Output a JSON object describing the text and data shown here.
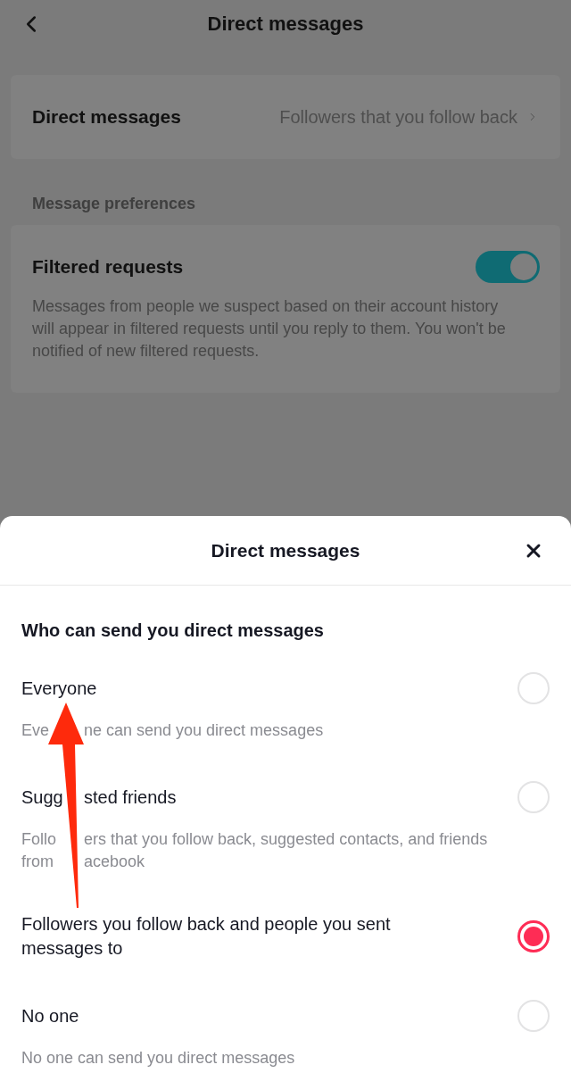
{
  "header": {
    "title": "Direct messages"
  },
  "direct_messages": {
    "label": "Direct messages",
    "value": "Followers that you follow back"
  },
  "message_preferences": {
    "title": "Message preferences",
    "filtered_requests": {
      "label": "Filtered requests",
      "on": true,
      "description": "Messages from people we suspect based on their account history will appear in filtered requests until you reply to them. You won't be notified of new filtered requests."
    }
  },
  "sheet": {
    "title": "Direct messages",
    "heading": "Who can send you direct messages",
    "options": [
      {
        "label_fragments": [
          "Everyone"
        ],
        "description_lines": [
          [
            "Eve",
            "ne can send you direct messages"
          ]
        ],
        "selected": false
      },
      {
        "label_fragments": [
          "Sugg",
          "sted friends"
        ],
        "description_lines": [
          [
            "Follo",
            "ers that you follow back, suggested contacts, and friends"
          ],
          [
            "from",
            "acebook"
          ]
        ],
        "selected": false
      },
      {
        "label_fragments": [
          "Followers you follow back and people you sent messages to"
        ],
        "selected": true
      },
      {
        "label_fragments": [
          "No one"
        ],
        "description_lines": [
          [
            "No one can send you direct messages"
          ]
        ],
        "selected": false
      }
    ]
  }
}
